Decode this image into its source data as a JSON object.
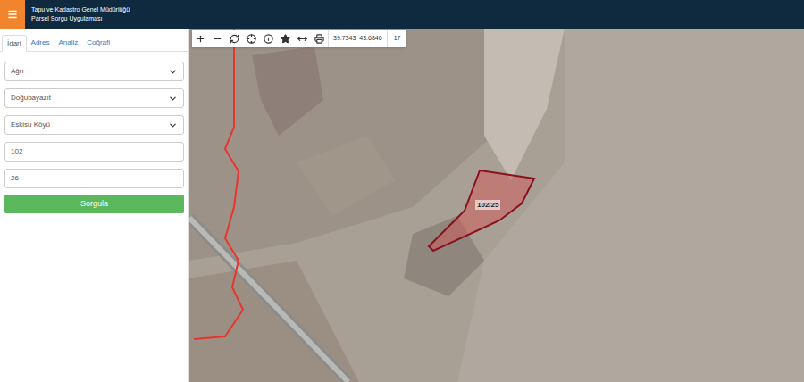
{
  "header": {
    "title": "Tapu ve Kadastro Genel Müdürlüğü",
    "subtitle": "Parsel Sorgu Uygulaması"
  },
  "tabs": [
    {
      "label": "İdari",
      "selected": true
    },
    {
      "label": "Adres",
      "selected": false
    },
    {
      "label": "Analiz",
      "selected": false
    },
    {
      "label": "Coğrafi",
      "selected": false
    }
  ],
  "form": {
    "fields": [
      {
        "kind": "select",
        "value": "Ağrı"
      },
      {
        "kind": "select",
        "value": "Doğubayazıt"
      },
      {
        "kind": "select",
        "value": "Eskisu Köyü"
      },
      {
        "kind": "input",
        "value": "102"
      },
      {
        "kind": "input",
        "value": "26"
      }
    ],
    "submit": "Sorgula"
  },
  "toolbar": {
    "coordinates": [
      "39.7343",
      "43.6846"
    ],
    "zoom": "17"
  },
  "map": {
    "parcel": {
      "label": "102/25"
    }
  }
}
